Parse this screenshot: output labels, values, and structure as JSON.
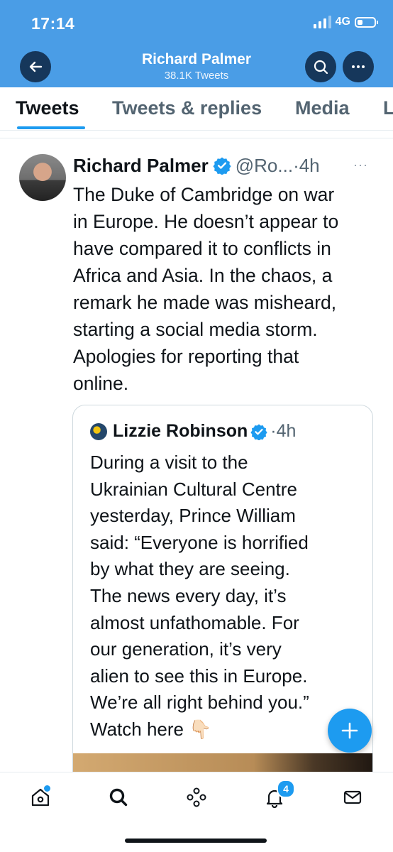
{
  "status_bar": {
    "time": "17:14",
    "network": "4G",
    "battery_level": 0.3
  },
  "header": {
    "title": "Richard Palmer",
    "subtitle": "38.1K Tweets"
  },
  "tabs": [
    {
      "label": "Tweets",
      "active": true
    },
    {
      "label": "Tweets & replies",
      "active": false
    },
    {
      "label": "Media",
      "active": false
    },
    {
      "label": "L",
      "active": false
    }
  ],
  "tweet": {
    "name": "Richard Palmer",
    "handle": "@Ro...",
    "time": "·4h",
    "more": "···",
    "text": "The Duke of Cambridge on war\nin Europe. He doesn’t appear to\nhave compared it to conflicts in\nAfrica and Asia. In the chaos, a\nremark he made was misheard,\nstarting a social media storm.\nApologies for reporting that\nonline.",
    "quote": {
      "name": "Lizzie Robinson",
      "time": "·4h",
      "text": "During a visit to the\nUkrainian Cultural Centre\nyesterday, Prince William\nsaid: “Everyone is horrified\nby what they are seeing.\nThe news every day, it’s\nalmost unfathomable. For\nour generation, it’s very\nalien to see this in Europe.\nWe’re all right behind you.”\nWatch here 👇🏻"
    }
  },
  "bottom_nav": {
    "notifications_count": "4"
  },
  "colors": {
    "header_bg": "#4a9de6",
    "accent": "#1d9bf0",
    "text": "#0f1419",
    "muted": "#536471"
  }
}
